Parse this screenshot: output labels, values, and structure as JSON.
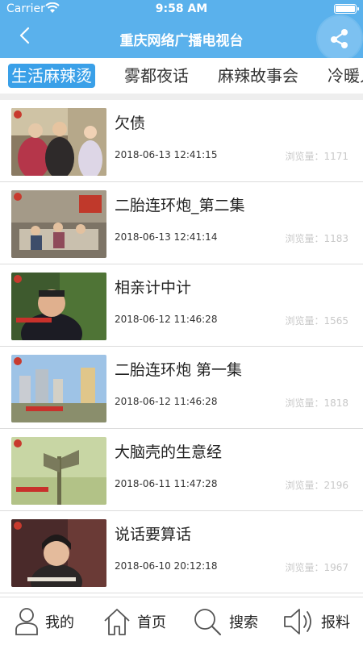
{
  "status_bar": {
    "carrier": "Carrier",
    "time": "9:58 AM"
  },
  "nav": {
    "title": "重庆网络广播电视台"
  },
  "tabs": [
    {
      "label": "生活麻辣烫",
      "active": true
    },
    {
      "label": "雾都夜话",
      "active": false
    },
    {
      "label": "麻辣故事会",
      "active": false
    },
    {
      "label": "冷暖人",
      "active": false
    }
  ],
  "items": [
    {
      "title": "欠债",
      "date": "2018-06-13 12:41:15",
      "views": "浏览量：1171"
    },
    {
      "title": "二胎连环炮_第二集",
      "date": "2018-06-13 12:41:14",
      "views": "浏览量：1183"
    },
    {
      "title": "相亲计中计",
      "date": "2018-06-12 11:46:28",
      "views": "浏览量：1565"
    },
    {
      "title": "二胎连环炮 第一集",
      "date": "2018-06-12 11:46:28",
      "views": "浏览量：1818"
    },
    {
      "title": "大脑壳的生意经",
      "date": "2018-06-11 11:47:28",
      "views": "浏览量：2196"
    },
    {
      "title": "说话要算话",
      "date": "2018-06-10 20:12:18",
      "views": "浏览量：1967"
    }
  ],
  "bottom_nav": [
    {
      "label": "我的",
      "icon": "person-icon"
    },
    {
      "label": "首页",
      "icon": "home-icon"
    },
    {
      "label": "搜索",
      "icon": "search-icon"
    },
    {
      "label": "报料",
      "icon": "speaker-icon"
    }
  ],
  "colors": {
    "header": "#5ab1ec",
    "active_tab": "#3aa0e8"
  }
}
